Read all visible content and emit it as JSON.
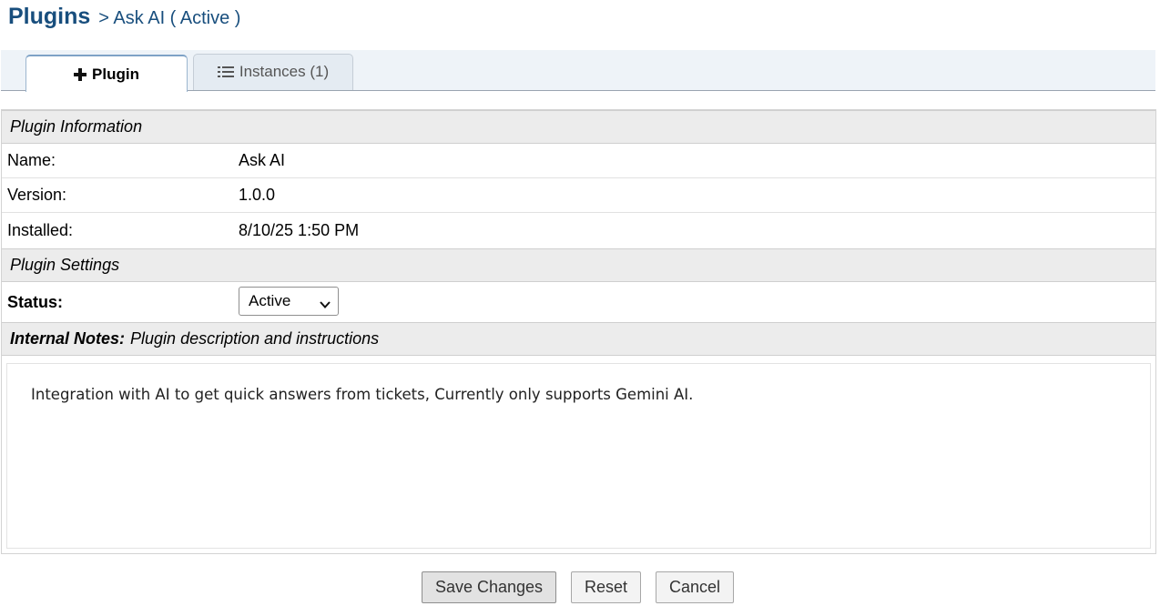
{
  "header": {
    "title": "Plugins",
    "breadcrumb": "> Ask AI ( Active )"
  },
  "tabs": [
    {
      "label": "Plugin",
      "icon": "plus-icon",
      "active": true
    },
    {
      "label": "Instances (1)",
      "icon": "list-icon",
      "active": false
    }
  ],
  "plugin_info": {
    "heading": "Plugin Information",
    "rows": [
      {
        "label": "Name:",
        "value": "Ask AI"
      },
      {
        "label": "Version:",
        "value": "1.0.0"
      },
      {
        "label": "Installed:",
        "value": "8/10/25 1:50 PM"
      }
    ]
  },
  "plugin_settings": {
    "heading": "Plugin Settings",
    "status_label": "Status:",
    "status_value": "Active"
  },
  "notes": {
    "heading_bold": "Internal Notes:",
    "heading_rest": "Plugin description and instructions",
    "text": "Integration with AI to get quick answers from tickets, Currently only supports Gemini AI."
  },
  "actions": {
    "save_label": "Save Changes",
    "reset_label": "Reset",
    "cancel_label": "Cancel"
  },
  "colors": {
    "title": "#184e7d",
    "section_bg": "#ececec",
    "tabbar_bg": "#eef3f8"
  }
}
